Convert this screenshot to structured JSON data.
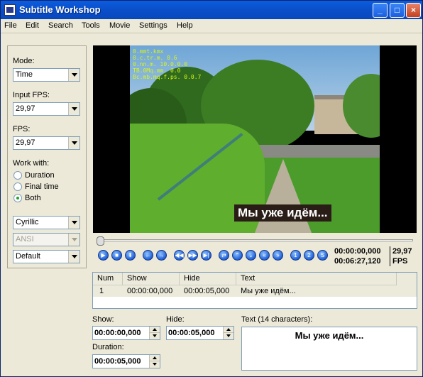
{
  "window": {
    "title": "Subtitle Workshop"
  },
  "menu": [
    "File",
    "Edit",
    "Search",
    "Tools",
    "Movie",
    "Settings",
    "Help"
  ],
  "menu_underline": [
    "F",
    "E",
    "S",
    "T",
    "M",
    "S",
    "H"
  ],
  "left": {
    "mode_label": "Mode:",
    "mode_value": "Time",
    "input_fps_label": "Input FPS:",
    "input_fps_value": "29,97",
    "fps_label": "FPS:",
    "fps_value": "29,97",
    "work_with_label": "Work with:",
    "radios": [
      {
        "label": "Duration",
        "checked": false
      },
      {
        "label": "Final time",
        "checked": false
      },
      {
        "label": "Both",
        "checked": true
      }
    ],
    "charset_value": "Cyrillic",
    "format_value": "ANSI",
    "style_value": "Default"
  },
  "video": {
    "subtitle": "Мы уже идём...",
    "osd": [
      "0.mmt.kmx",
      "0.c.tr.m. 0.6",
      "0.nn.m. 10.0.0.0",
      "TB.0Mq.mm. 0.0",
      "Bc.mb.mq.f.ps. 0.0.7"
    ]
  },
  "playback": {
    "position": "00:00:00,000",
    "length": "00:06:27,120",
    "fps_value": "29,97",
    "fps_label": "FPS",
    "seek_fraction": 0.0
  },
  "grid": {
    "columns": [
      "Num",
      "Show",
      "Hide",
      "Text"
    ],
    "rows": [
      {
        "num": "1",
        "show": "00:00:00,000",
        "hide": "00:00:05,000",
        "text": "Мы уже идём..."
      }
    ]
  },
  "bottom": {
    "show_label": "Show:",
    "show_value": "00:00:00,000",
    "hide_label": "Hide:",
    "hide_value": "00:00:05,000",
    "duration_label": "Duration:",
    "duration_value": "00:00:05,000",
    "text_label": "Text (14 characters):",
    "text_value": "Мы уже идём..."
  },
  "icons": [
    "play-icon",
    "stop-icon",
    "step-down-icon",
    "back-icon",
    "forward-icon",
    "rewind-icon",
    "fast-forward-icon",
    "next-frame-icon",
    "set-start-icon",
    "set-end-icon",
    "set-both-icon",
    "prev-subtitle-icon",
    "next-subtitle-icon",
    "sync-1-icon",
    "sync-2-icon",
    "sync-s-icon"
  ]
}
